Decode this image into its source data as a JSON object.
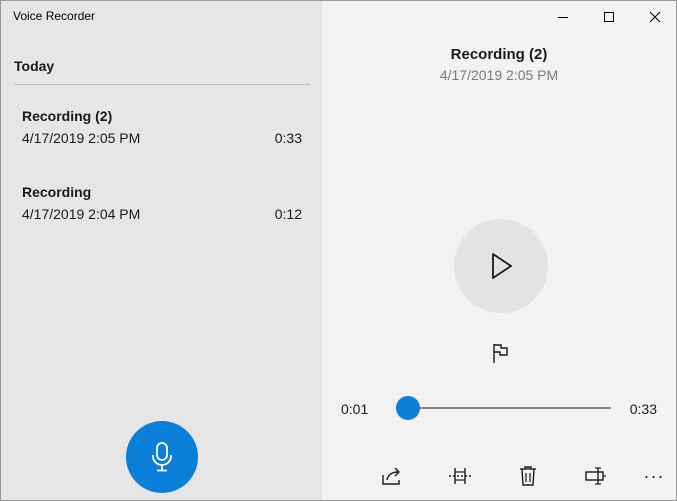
{
  "app": {
    "title": "Voice Recorder"
  },
  "window_controls": {
    "minimize_icon": "minimize-icon",
    "maximize_icon": "maximize-icon",
    "close_icon": "close-icon"
  },
  "list": {
    "group_label": "Today",
    "items": [
      {
        "name": "Recording (2)",
        "date": "4/17/2019 2:05 PM",
        "duration": "0:33",
        "selected": true
      },
      {
        "name": "Recording",
        "date": "4/17/2019 2:04 PM",
        "duration": "0:12",
        "selected": false
      }
    ]
  },
  "record_button": {
    "icon": "microphone-icon",
    "color": "#0a7fd8"
  },
  "detail": {
    "title": "Recording (2)",
    "date": "4/17/2019 2:05 PM",
    "play_icon": "play-icon",
    "marker_icon": "flag-icon"
  },
  "playback": {
    "current_time": "0:01",
    "total_time": "0:33",
    "progress_fraction": 0.03
  },
  "toolbar": {
    "items": [
      {
        "name": "share-icon"
      },
      {
        "name": "trim-icon"
      },
      {
        "name": "delete-icon"
      },
      {
        "name": "rename-icon"
      },
      {
        "name": "more-icon",
        "label": "···"
      }
    ]
  },
  "colors": {
    "accent": "#0a7fd8",
    "left_pane_bg": "#e6e6e6",
    "right_pane_bg": "#f2f2f2"
  }
}
